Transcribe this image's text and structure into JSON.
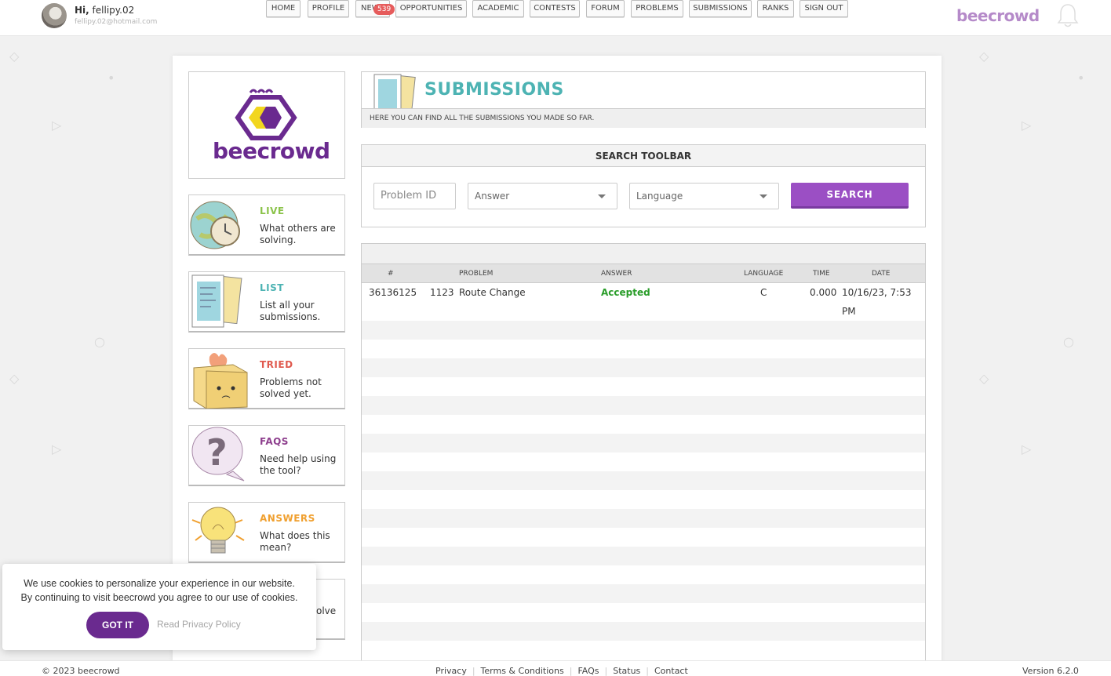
{
  "user": {
    "greeting": "Hi,",
    "name": "fellipy.02",
    "email": "fellipy.02@hotmail.com"
  },
  "nav": {
    "items": [
      "HOME",
      "PROFILE",
      "NEWS",
      "OPPORTUNITIES",
      "ACADEMIC",
      "CONTESTS",
      "FORUM",
      "PROBLEMS",
      "SUBMISSIONS",
      "RANKS",
      "SIGN OUT"
    ],
    "news_badge": "539"
  },
  "brand": "beecrowd",
  "logo_word": "beecrowd",
  "sidebar": [
    {
      "title": "LIVE",
      "desc": "What others are solving.",
      "color": "#8bc34a"
    },
    {
      "title": "LIST",
      "desc": "List all your submissions.",
      "color": "#4db3b3"
    },
    {
      "title": "TRIED",
      "desc": "Problems not solved yet.",
      "color": "#e05a4f"
    },
    {
      "title": "FAQS",
      "desc": "Need help using the tool?",
      "color": "#8e3f8e"
    },
    {
      "title": "ANSWERS",
      "desc": "What does this mean?",
      "color": "#f0a030"
    },
    {
      "title": "",
      "desc": "olve",
      "color": "#333"
    }
  ],
  "submissions": {
    "title": "SUBMISSIONS",
    "subtitle": "HERE YOU CAN FIND ALL THE SUBMISSIONS YOU MADE SO FAR."
  },
  "search": {
    "title": "SEARCH TOOLBAR",
    "problem_placeholder": "Problem ID",
    "answer_value": "Answer",
    "language_value": "Language",
    "button": "SEARCH"
  },
  "table": {
    "headers": {
      "id": "#",
      "problem": "PROBLEM",
      "answer": "ANSWER",
      "language": "LANGUAGE",
      "time": "TIME",
      "date": "DATE"
    },
    "rows": [
      {
        "id": "36136125",
        "problem_num": "1123",
        "problem_name": "Route Change",
        "answer": "Accepted",
        "language": "C",
        "time": "0.000",
        "date": "10/16/23, 7:53 PM"
      }
    ]
  },
  "cookie": {
    "text": "We use cookies to personalize your experience in our website. By continuing to visit beecrowd you agree to our use of cookies.",
    "button": "GOT IT",
    "link": "Read Privacy Policy"
  },
  "footer": {
    "copyright": "© 2023 beecrowd",
    "links": [
      "Privacy",
      "Terms & Conditions",
      "FAQs",
      "Status",
      "Contact"
    ],
    "version": "Version 6.2.0"
  },
  "colors": {
    "accent": "#9b4fc4",
    "brand": "#6a2a8f",
    "teal": "#4db3b3",
    "accepted": "#2a9d2a"
  }
}
